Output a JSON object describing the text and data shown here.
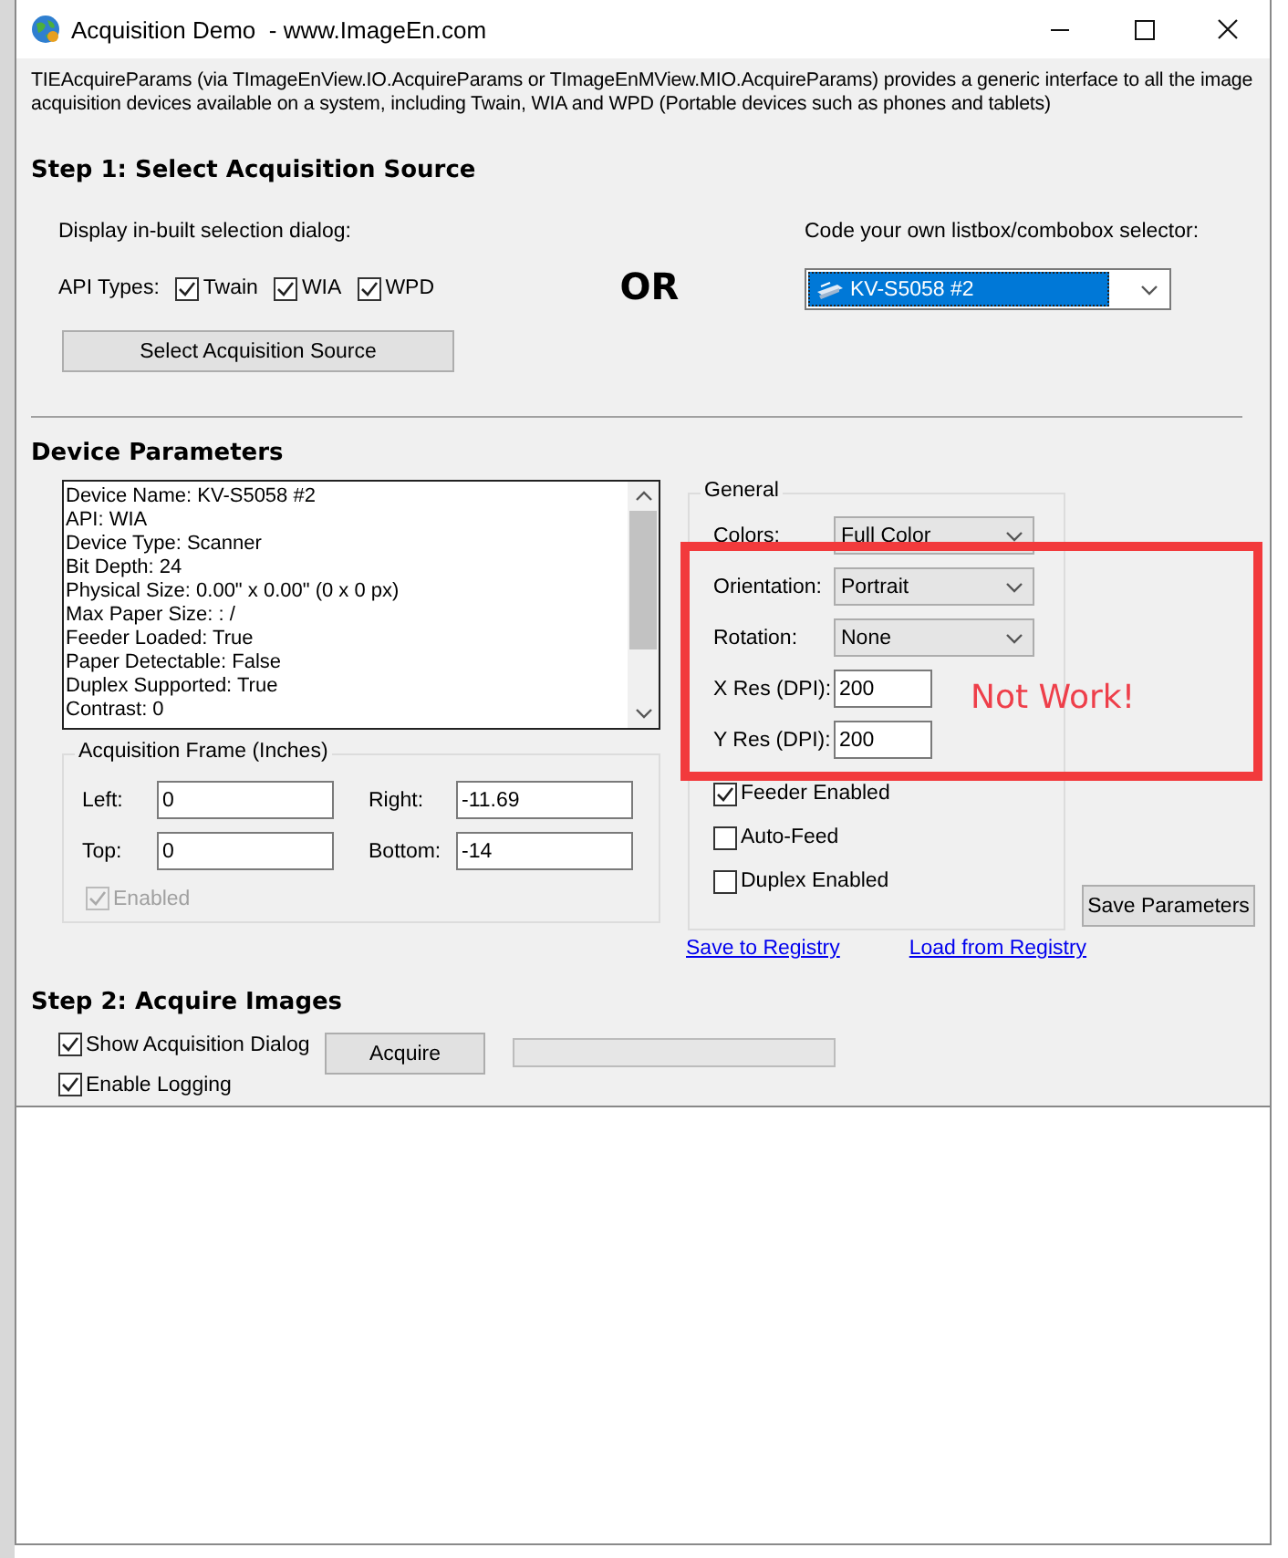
{
  "window": {
    "title": "Acquisition Demo  - www.ImageEn.com"
  },
  "description": "TIEAcquireParams (via TImageEnView.IO.AcquireParams or TImageEnMView.MIO.AcquireParams) provides a generic interface to all the image acquisition devices available on a system, including Twain, WIA and WPD (Portable devices such as phones and tablets)",
  "step1": {
    "heading": "Step 1: Select Acquisition Source",
    "builtin_label": "Display in-built selection dialog:",
    "api_types_label": "API Types:",
    "api_types": [
      {
        "label": "Twain",
        "checked": true
      },
      {
        "label": "WIA",
        "checked": true
      },
      {
        "label": "WPD",
        "checked": true
      }
    ],
    "select_button": "Select Acquisition Source",
    "or_label": "OR",
    "custom_label": "Code your own listbox/combobox selector:",
    "device_combo": {
      "value": "KV-S5058 #2"
    }
  },
  "device_parameters": {
    "heading": "Device Parameters",
    "info_lines": [
      "Device Name: KV-S5058 #2",
      "API: WIA",
      "Device Type: Scanner",
      "Bit Depth: 24",
      "Physical Size: 0.00\" x 0.00\" (0 x 0 px)",
      "Max Paper Size: : /",
      "Feeder Loaded: True",
      "Paper Detectable: False",
      "Duplex Supported: True",
      "Contrast: 0"
    ],
    "frame": {
      "title": "Acquisition Frame (Inches)",
      "fields": [
        {
          "label": "Left:",
          "value": "0"
        },
        {
          "label": "Right:",
          "value": "-11.69"
        },
        {
          "label": "Top:",
          "value": "0"
        },
        {
          "label": "Bottom:",
          "value": "-14"
        }
      ],
      "enabled": {
        "label": "Enabled",
        "checked": true,
        "disabled": true
      }
    },
    "general": {
      "title": "General",
      "settings": [
        {
          "kind": "combo",
          "label": "Colors:",
          "value": "Full Color"
        },
        {
          "kind": "combo",
          "label": "Orientation:",
          "value": "Portrait"
        },
        {
          "kind": "combo",
          "label": "Rotation:",
          "value": "None"
        },
        {
          "kind": "input",
          "label": "X Res (DPI):",
          "value": "200"
        },
        {
          "kind": "input",
          "label": "Y Res (DPI):",
          "value": "200"
        }
      ],
      "options": [
        {
          "label": "Feeder Enabled",
          "checked": true
        },
        {
          "label": "Auto-Feed",
          "checked": false
        },
        {
          "label": "Duplex Enabled",
          "checked": false
        }
      ]
    },
    "save_button": "Save Parameters",
    "links": [
      "Save to Registry",
      "Load from Registry"
    ]
  },
  "step2": {
    "heading": "Step 2: Acquire Images",
    "options": [
      {
        "label": "Show Acquisition Dialog",
        "checked": true
      },
      {
        "label": "Enable Logging",
        "checked": true
      }
    ],
    "acquire_button": "Acquire",
    "progress": {
      "level": 0
    }
  },
  "annotation": {
    "text": "Not Work!"
  }
}
